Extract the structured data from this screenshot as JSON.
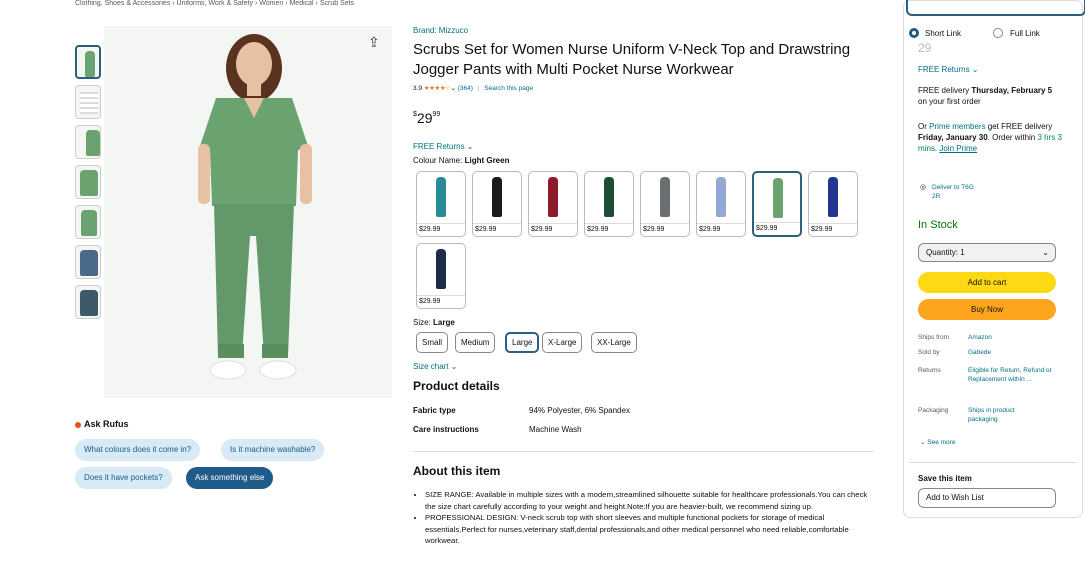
{
  "breadcrumb": "Clothing, Shoes & Accessories › Uniforms, Work & Safety › Women › Medical › Scrub Sets",
  "share_icon": "share-icon",
  "brand": "Brand: Mizzuco",
  "title": "Scrubs Set for Women Nurse Uniform V-Neck Top and Drawstring Jogger Pants with Multi Pocket Nurse Workwear",
  "rating": {
    "value": "3.9",
    "stars": "★★★★☆",
    "count": "(364)",
    "separator": "|",
    "search_link": "Search this page"
  },
  "price": {
    "currency": "$",
    "whole": "29",
    "fraction": "99"
  },
  "free_returns": "FREE Returns ⌄",
  "colour": {
    "label": "Colour Name: ",
    "value": "Light Green"
  },
  "swatches": [
    {
      "price": "$29.99",
      "color": "#2a8a96"
    },
    {
      "price": "$29.99",
      "color": "#1a1a1a"
    },
    {
      "price": "$29.99",
      "color": "#8e1b2c"
    },
    {
      "price": "$29.99",
      "color": "#1d4d34"
    },
    {
      "price": "$29.99",
      "color": "#6b6f72"
    },
    {
      "price": "$29.99",
      "color": "#93a8d6"
    },
    {
      "price": "$29.99",
      "color": "#6aa36f"
    },
    {
      "price": "$29.99",
      "color": "#24358f"
    },
    {
      "price": "$29.99",
      "color": "#1e2a4a"
    }
  ],
  "size": {
    "label": "Size: ",
    "value": "Large",
    "options": [
      "Small",
      "Medium",
      "Large",
      "X-Large",
      "XX-Large"
    ],
    "chart_link": "Size chart ⌄"
  },
  "product_details": {
    "title": "Product details",
    "rows": [
      {
        "key": "Fabric type",
        "value": "94% Polyester, 6% Spandex"
      },
      {
        "key": "Care instructions",
        "value": "Machine Wash"
      }
    ]
  },
  "about": {
    "title": "About this item",
    "bullets": [
      "SIZE RANGE: Available in multiple sizes with a modern,streamlined silhouette suitable for healthcare professionals.You can check the size chart carefully according to your weight and height.Note:If you are heavier-built, we recommend sizing up.",
      "PROFESSIONAL DESIGN: V-neck scrub top with short sleeves and multiple functional pockets for storage of medical essentials,Perfect for nurses,veterinary staff,dental professionals,and other medical personnel who need reliable,comfortable workwear."
    ]
  },
  "rufus": {
    "title": "Ask Rufus",
    "chips": [
      "What colours does it come in?",
      "Is it machine washable?",
      "Does it have pockets?"
    ],
    "ask_button": "Ask something else"
  },
  "link_options": {
    "short": "Short Link",
    "full": "Full Link"
  },
  "buybox": {
    "price_partial": "29",
    "free_returns": "FREE Returns ⌄",
    "delivery_1": "FREE delivery ",
    "delivery_1_bold": "Thursday, February 5",
    "delivery_1_tail": " on your first order",
    "prime_pre": "Or ",
    "prime_link": "Prime members",
    "prime_mid": " get FREE delivery ",
    "prime_bold": "Friday, January 30",
    "order_within": ". Order within ",
    "order_time": "3 hrs 3 mins",
    "join_link": "Join Prime",
    "deliver_to": "Deliver to  T6G 2R",
    "stock": "In Stock",
    "quantity": "Quantity: 1",
    "add_to_cart": "Add to cart",
    "buy_now": "Buy Now",
    "info": [
      {
        "key": "Ships from",
        "value": "Amazon"
      },
      {
        "key": "Sold by",
        "value": "Gabede"
      },
      {
        "key": "Returns",
        "value": "Eligible for Return, Refund or Replacement within ..."
      },
      {
        "key": "Packaging",
        "value": "Ships in product packaging"
      }
    ],
    "see_more": "⌄ See more",
    "save_title": "Save this item",
    "wish_list": "Add to Wish List"
  }
}
